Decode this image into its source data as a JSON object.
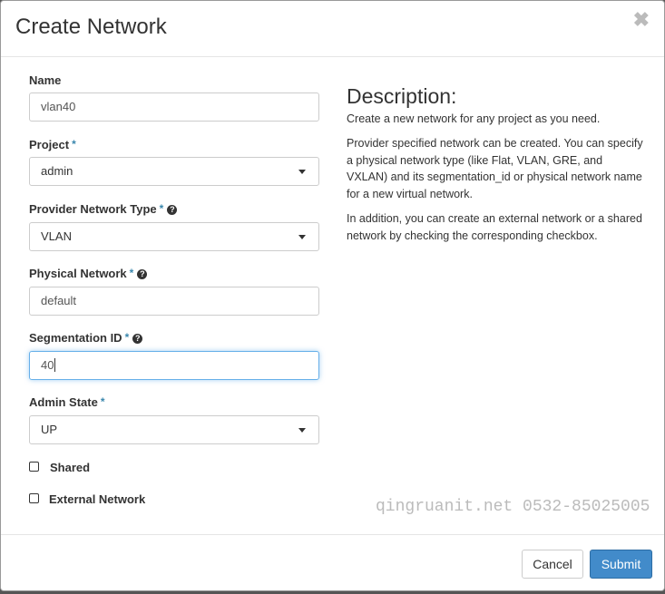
{
  "dialog": {
    "title": "Create Network",
    "close_icon": "close-icon"
  },
  "form": {
    "name": {
      "label": "Name",
      "value": "vlan40"
    },
    "project": {
      "label": "Project",
      "required": "*",
      "value": "admin"
    },
    "provider_network_type": {
      "label": "Provider Network Type",
      "required": "*",
      "value": "VLAN",
      "help_icon": "question-circle-icon"
    },
    "physical_network": {
      "label": "Physical Network",
      "required": "*",
      "value": "default",
      "help_icon": "question-circle-icon"
    },
    "segmentation_id": {
      "label": "Segmentation ID",
      "required": "*",
      "value": "40",
      "help_icon": "question-circle-icon"
    },
    "admin_state": {
      "label": "Admin State",
      "required": "*",
      "value": "UP"
    },
    "shared": {
      "label": "Shared",
      "checked": false
    },
    "external_network": {
      "label": "External Network",
      "checked": false
    }
  },
  "description": {
    "title": "Description:",
    "paragraphs": [
      "Create a new network for any project as you need.",
      "Provider specified network can be created. You can specify a physical network type (like Flat, VLAN, GRE, and VXLAN) and its segmentation_id or physical network name for a new virtual network.",
      "In addition, you can create an external network or a shared network by checking the corresponding checkbox."
    ]
  },
  "watermark": "qingruanit.net 0532-85025005",
  "footer": {
    "cancel_label": "Cancel",
    "submit_label": "Submit"
  },
  "colors": {
    "primary": "#428bca",
    "required": "#3a87ad",
    "focus": "#66afe9"
  }
}
